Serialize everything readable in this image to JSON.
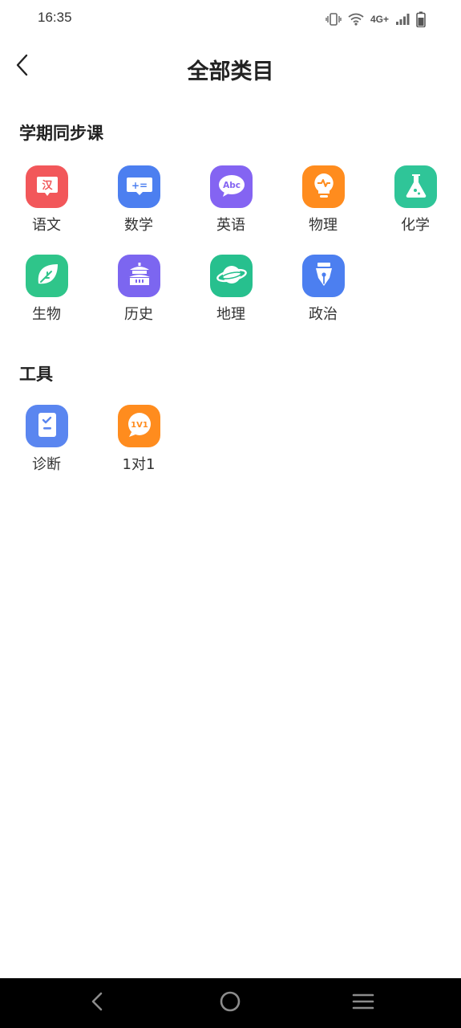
{
  "status_bar": {
    "time": "16:35",
    "network": "4G+"
  },
  "header": {
    "title": "全部类目"
  },
  "sections": {
    "courses": {
      "title": "学期同步课",
      "items": [
        {
          "label": "语文",
          "icon": "chinese-char-icon",
          "color": "#F2575A",
          "glyph": "汉"
        },
        {
          "label": "数学",
          "icon": "math-equation-icon",
          "color": "#4C7FF0",
          "glyph": "+="
        },
        {
          "label": "英语",
          "icon": "abc-bubble-icon",
          "color": "#8464F2",
          "glyph": "Abc"
        },
        {
          "label": "物理",
          "icon": "pulse-bulb-icon",
          "color": "#FF8C1E",
          "glyph": ""
        },
        {
          "label": "化学",
          "icon": "flask-icon",
          "color": "#2FC598",
          "glyph": ""
        },
        {
          "label": "生物",
          "icon": "leaf-icon",
          "color": "#2FC58A",
          "glyph": ""
        },
        {
          "label": "历史",
          "icon": "temple-icon",
          "color": "#7C66F0",
          "glyph": ""
        },
        {
          "label": "地理",
          "icon": "planet-icon",
          "color": "#27C08E",
          "glyph": ""
        },
        {
          "label": "政治",
          "icon": "pen-nib-icon",
          "color": "#4C7FF0",
          "glyph": ""
        }
      ]
    },
    "tools": {
      "title": "工具",
      "items": [
        {
          "label": "诊断",
          "icon": "checklist-icon",
          "color": "#5A86F0",
          "glyph": ""
        },
        {
          "label": "1对1",
          "icon": "one-on-one-chat-icon",
          "color": "#FF8C1E",
          "glyph": "1V1"
        }
      ]
    }
  },
  "nav_bar": {
    "back_icon": "nav-back-icon",
    "home_icon": "nav-home-icon",
    "menu_icon": "nav-menu-icon"
  }
}
